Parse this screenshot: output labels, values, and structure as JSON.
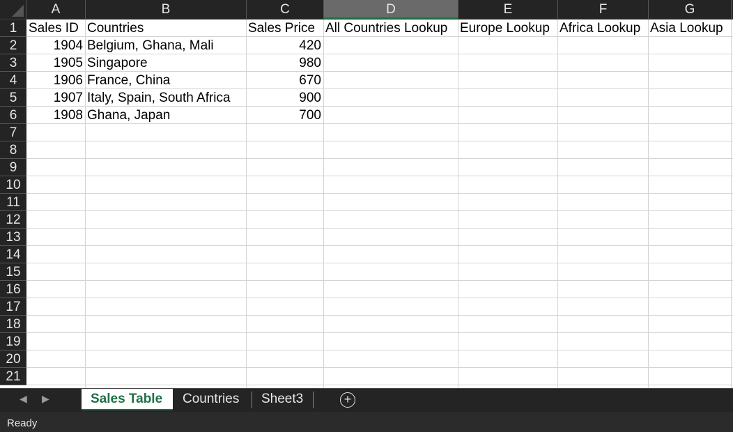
{
  "columns": [
    "A",
    "B",
    "C",
    "D",
    "E",
    "F",
    "G"
  ],
  "selected_column": "D",
  "row_numbers": [
    "1",
    "2",
    "3",
    "4",
    "5",
    "6",
    "7",
    "8",
    "9",
    "10",
    "11",
    "12",
    "13",
    "14",
    "15",
    "16",
    "17",
    "18",
    "19",
    "20",
    "21"
  ],
  "header_row": [
    "Sales ID",
    "Countries",
    "Sales Price",
    "All Countries Lookup",
    "Europe Lookup",
    "Africa Lookup",
    "Asia Lookup"
  ],
  "rows": [
    {
      "id": "1904",
      "countries": "Belgium, Ghana, Mali",
      "price": "420"
    },
    {
      "id": "1905",
      "countries": "Singapore",
      "price": "980"
    },
    {
      "id": "1906",
      "countries": "France, China",
      "price": "670"
    },
    {
      "id": "1907",
      "countries": "Italy, Spain, South Africa",
      "price": "900"
    },
    {
      "id": "1908",
      "countries": "Ghana, Japan",
      "price": "700"
    }
  ],
  "sheet_tabs": [
    {
      "label": "Sales Table",
      "active": true
    },
    {
      "label": "Countries",
      "active": false
    },
    {
      "label": "Sheet3",
      "active": false
    }
  ],
  "icons": {
    "prev": "◀",
    "next": "▶",
    "add": "+"
  },
  "status": "Ready",
  "colors": {
    "accent": "#1e7145",
    "header_bg": "#242424",
    "selected_header_bg": "#6a6a6a"
  }
}
